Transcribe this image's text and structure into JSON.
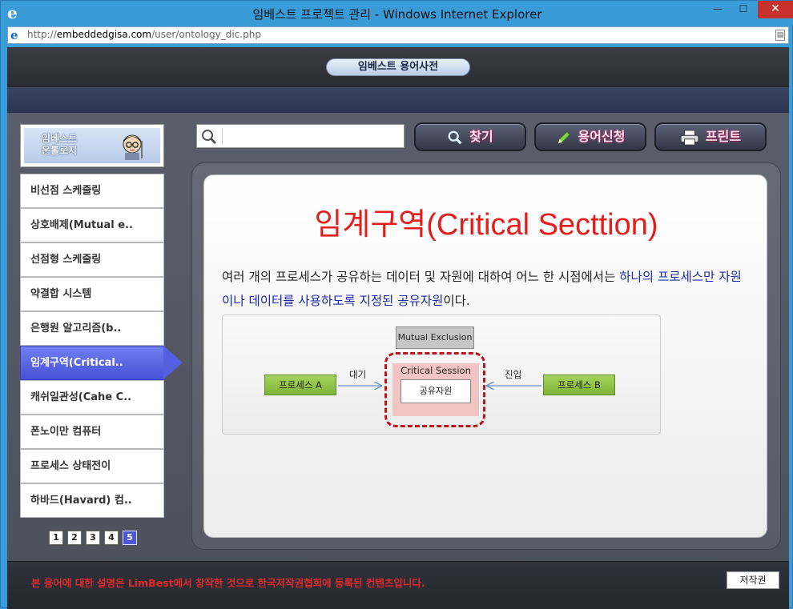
{
  "window": {
    "title": "임베스트 프로젝트 관리 - Windows Internet Explorer",
    "url_prefix": "http://",
    "url_host": "embeddedgisa.com",
    "url_path": "/user/ontology_dic.php"
  },
  "header": {
    "title": "임베스트 용어사전"
  },
  "logo": {
    "line1": "임베스트",
    "line2": "온톨로지"
  },
  "search": {
    "value": "",
    "placeholder": ""
  },
  "toolbar": {
    "find_label": "찾기",
    "request_label": "용어신청",
    "print_label": "프린트"
  },
  "sidebar": {
    "items": [
      {
        "label": "비선점 스케줄링"
      },
      {
        "label": "상호배제(Mutual e.."
      },
      {
        "label": "선점형 스케줄링"
      },
      {
        "label": "약결합 시스템"
      },
      {
        "label": "은행원 알고리즘(b.."
      },
      {
        "label": "임계구역(Critical.."
      },
      {
        "label": "캐쉬일관성(Cahe C.."
      },
      {
        "label": "폰노이만 컴퓨터"
      },
      {
        "label": "프로세스 상태전이"
      },
      {
        "label": "하바드(Havard) 컴.."
      }
    ],
    "active_index": 5
  },
  "pager": {
    "pages": [
      "1",
      "2",
      "3",
      "4",
      "5"
    ],
    "current": "5"
  },
  "term": {
    "title": "임계구역(Critical Secttion)",
    "desc_part1": "여러 개의 프로세스가 공유하는 데이터 및 자원에 대하여 어느 한 시점에서는 ",
    "desc_highlight": "하나의 프로세스만 자원이나 데이터를 사용하도록 지정된 공유자원",
    "desc_part2": "이다."
  },
  "diagram": {
    "mutex": "Mutual Exclusion",
    "critical_session": "Critical Session",
    "shared_resource": "공유자원",
    "process_a": "프로세스 A",
    "process_b": "프로세스 B",
    "wait": "대기",
    "enter": "진입"
  },
  "footer": {
    "copyright": "본 용어에 대한 설명은 LimBest에서 창작한 것으로 한국저작권협회에 등록된 컨텐츠입니다.",
    "copyright_button": "저작권"
  },
  "colors": {
    "title_red": "#e41d1d",
    "highlight_blue": "#1c2aa6",
    "active_item": "#5361e0",
    "footer_red": "#e22a2a"
  },
  "icons": [
    "ie-icon",
    "search-icon",
    "magnifier-icon",
    "pencil-icon",
    "printer-icon"
  ]
}
